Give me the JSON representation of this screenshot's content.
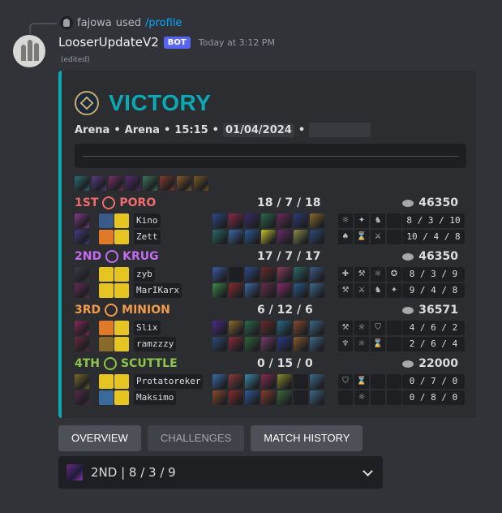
{
  "reply": {
    "user": "fajowa",
    "verb": "used",
    "command": "/profile"
  },
  "message": {
    "username": "LooserUpdateV2",
    "bot_tag": "BOT",
    "timestamp": "Today at 3:12 PM",
    "edited": "(edited)"
  },
  "embed": {
    "accent": "#0aa9b4",
    "title": "VICTORY",
    "meta": {
      "mode1": "Arena",
      "mode2": "Arena",
      "duration": "15:15",
      "date": "01/04/2024",
      "sep": "•"
    },
    "bans": [
      "#2a6f7a",
      "#5b3a8a",
      "#7a2e6a",
      "#5a2a7a",
      "#3a7a5a",
      "#8a3a2a",
      "#8a5a2a",
      "#7a5a1e"
    ],
    "teams": [
      {
        "place": "1ST",
        "pet": "PORO",
        "color": "#f06c6c",
        "kda": "18 / 7 / 18",
        "score": "46350",
        "players": [
          {
            "name": "Kino",
            "stat": "8 / 3 / 10",
            "champ": "#8a3a8a",
            "spells": [
              "#3a5a8a",
              "#e6c422"
            ],
            "items": [
              "#2a4a8a",
              "#8a2a4a",
              "#3a2a6a",
              "#2a6a4a",
              "#6a2a5a",
              "#2a3a7a",
              "#8a6a2a"
            ],
            "aug": [
              "☼",
              "✦",
              "♞",
              ""
            ]
          },
          {
            "name": "Zett",
            "stat": "10 / 4 / 8",
            "champ": "#4a3a8a",
            "spells": [
              "#e07a2a",
              "#e6c422"
            ],
            "items": [
              "#2a6a6a",
              "#3a6aa8",
              "#2a5a9a",
              "#c8c02a",
              "#6a2a6a",
              "#8a8a4a",
              "#2a4a7a"
            ],
            "aug": [
              "♠",
              "⌛",
              "⚔",
              ""
            ]
          }
        ]
      },
      {
        "place": "2ND",
        "pet": "KRUG",
        "color": "#c46cf0",
        "kda": "17 / 7 / 17",
        "score": "46350",
        "players": [
          {
            "name": "zyb",
            "stat": "8 / 3 / 9",
            "champ": "#3a3a4a",
            "spells": [
              "#e6c422",
              "#e6c422"
            ],
            "items": [
              "#3a5aa8",
              "#1e1f22",
              "#2a4a8a",
              "#6a2a2a",
              "#8a3a5a",
              "#2a6a6a",
              "#3a5a8a"
            ],
            "aug": [
              "✚",
              "⚒",
              "☼",
              "✪"
            ]
          },
          {
            "name": "MarIKarx",
            "stat": "9 / 4 / 8",
            "champ": "#6a2a5a",
            "spells": [
              "#e6c422",
              "#e6c422"
            ],
            "items": [
              "#3a8a4a",
              "#8a2a2a",
              "#3a6aa8",
              "#6a2a4a",
              "#8a2a6a",
              "#2a5a8a",
              "#3a6a8a"
            ],
            "aug": [
              "⚒",
              "⚔",
              "♞",
              "✦"
            ]
          }
        ]
      },
      {
        "place": "3RD",
        "pet": "MINION",
        "color": "#f09a4a",
        "kda": "6 / 12 / 6",
        "score": "36571",
        "players": [
          {
            "name": "Slix",
            "stat": "4 / 6 / 2",
            "champ": "#8a2a5a",
            "spells": [
              "#e07a2a",
              "#e6c422"
            ],
            "items": [
              "#4a2a8a",
              "#8a6a2a",
              "#2a6a4a",
              "#6a2a2a",
              "#2a6a8a",
              "#8a4a2a",
              "#3a6a8a"
            ],
            "aug": [
              "⚒",
              "☼",
              "⛉",
              ""
            ]
          },
          {
            "name": "ramzzzy",
            "stat": "2 / 6 / 4",
            "champ": "#6a2a3a",
            "spells": [
              "#8a6a2a",
              "#e6c422"
            ],
            "items": [
              "#2a4a7a",
              "#8a2a3a",
              "#2a6a3a",
              "#7a3a6a",
              "#2a3a8a",
              "#8a5a2a",
              "#3a6a8a"
            ],
            "aug": [
              "♆",
              "☼",
              "⌛",
              ""
            ]
          }
        ]
      },
      {
        "place": "4TH",
        "pet": "SCUTTLE",
        "color": "#8ec64a",
        "kda": "0 / 15 / 0",
        "score": "22000",
        "players": [
          {
            "name": "Protatoreker",
            "stat": "0 / 7 / 0",
            "champ": "#7a6a2a",
            "spells": [
              "#e6c422",
              "#e6c422"
            ],
            "items": [
              "#3a6aa8",
              "#8a3a3a",
              "#3a8aa8",
              "#8a2a4a",
              "#8a8a2a",
              "#1e1f22",
              "#3a6a8a"
            ],
            "aug": [
              "⛉",
              "⌛",
              "",
              ""
            ]
          },
          {
            "name": "Maksimo",
            "stat": "0 / 8 / 0",
            "champ": "#5a2a4a",
            "spells": [
              "#3a6a9a",
              "#e6c422"
            ],
            "items": [
              "#8a4a2a",
              "#8a2a2a",
              "#2a5a9a",
              "#8a3a2a",
              "#3a6a3a",
              "#1e1f22",
              "#3a6a8a"
            ],
            "aug": [
              "",
              "☼",
              "",
              ""
            ]
          }
        ]
      }
    ]
  },
  "buttons": {
    "overview": "OVERVIEW",
    "challenges": "CHALLENGES",
    "match_history": "MATCH HISTORY"
  },
  "select": {
    "value": "2ND | 8 / 3 / 9"
  }
}
